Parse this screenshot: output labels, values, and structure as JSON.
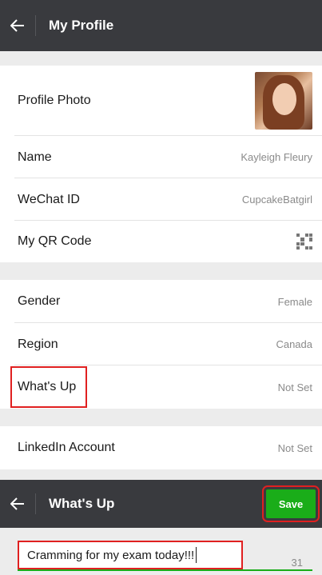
{
  "profile_screen": {
    "title": "My Profile",
    "rows": {
      "profile_photo": {
        "label": "Profile Photo"
      },
      "name": {
        "label": "Name",
        "value": "Kayleigh Fleury"
      },
      "wechat_id": {
        "label": "WeChat ID",
        "value": "CupcakeBatgirl"
      },
      "qr_code": {
        "label": "My QR Code",
        "icon": "qr-code-icon"
      },
      "gender": {
        "label": "Gender",
        "value": "Female"
      },
      "region": {
        "label": "Region",
        "value": "Canada"
      },
      "whats_up": {
        "label": "What's Up",
        "value": "Not Set"
      },
      "linkedin": {
        "label": "LinkedIn Account",
        "value": "Not Set"
      }
    }
  },
  "whats_up_screen": {
    "title": "What's Up",
    "save_label": "Save",
    "input_value": "Cramming for my exam today!!!",
    "char_count": "31"
  },
  "colors": {
    "top_bar": "#393a3e",
    "save_green": "#1aad19",
    "highlight_red": "#e02020",
    "background": "#ececec"
  }
}
